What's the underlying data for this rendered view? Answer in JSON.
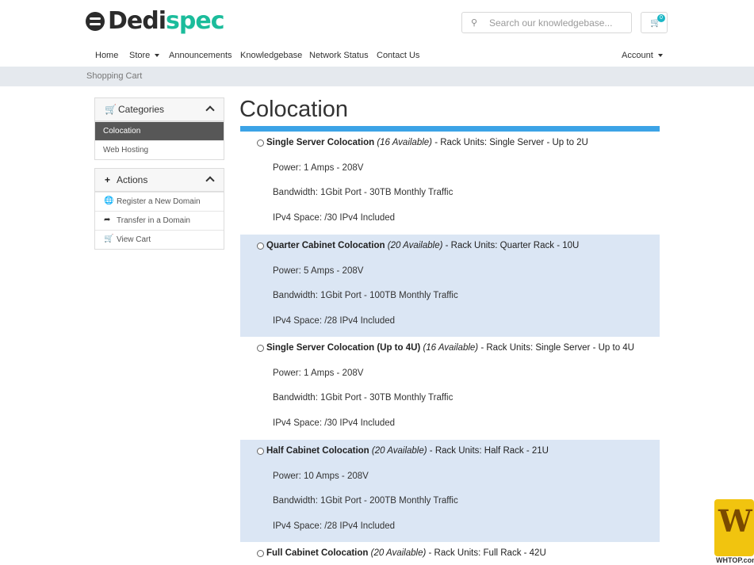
{
  "brand": {
    "part1": "Dedi",
    "part2": "spec",
    "accent": "#1bbc9b"
  },
  "search": {
    "placeholder": "Search our knowledgebase..."
  },
  "cart": {
    "count": "0"
  },
  "nav": {
    "home": "Home",
    "store": "Store",
    "announcements": "Announcements",
    "knowledgebase": "Knowledgebase",
    "network_status": "Network Status",
    "contact_us": "Contact Us",
    "account": "Account"
  },
  "breadcrumb": "Shopping Cart",
  "sidebar": {
    "categories": {
      "title": "Categories",
      "items": [
        {
          "label": "Colocation",
          "active": true
        },
        {
          "label": "Web Hosting",
          "active": false
        }
      ]
    },
    "actions": {
      "title": "Actions",
      "items": [
        {
          "label": "Register a New Domain",
          "icon": "globe-icon"
        },
        {
          "label": "Transfer in a Domain",
          "icon": "share-icon"
        },
        {
          "label": "View Cart",
          "icon": "cart-icon"
        }
      ]
    }
  },
  "page": {
    "title": "Colocation",
    "accent": "#3ca3e6"
  },
  "products": [
    {
      "name": "Single Server Colocation",
      "availability": "(16 Available)",
      "rack": " - Rack Units: Single Server - Up to 2U",
      "specs": [
        "Power: 1 Amps - 208V",
        "Bandwidth: 1Gbit Port - 30TB Monthly Traffic",
        "IPv4 Space: /30 IPv4 Included"
      ]
    },
    {
      "name": "Quarter Cabinet Colocation",
      "availability": "(20 Available)",
      "rack": " - Rack Units: Quarter Rack - 10U",
      "specs": [
        "Power: 5 Amps - 208V",
        "Bandwidth: 1Gbit Port - 100TB Monthly Traffic",
        "IPv4 Space: /28 IPv4 Included"
      ]
    },
    {
      "name": "Single Server Colocation (Up to 4U)",
      "availability": "(16 Available)",
      "rack": " - Rack Units: Single Server - Up to 4U",
      "specs": [
        "Power: 1 Amps - 208V",
        "Bandwidth: 1Gbit Port - 30TB Monthly Traffic",
        "IPv4 Space: /30 IPv4 Included"
      ]
    },
    {
      "name": "Half Cabinet Colocation",
      "availability": "(20 Available)",
      "rack": " - Rack Units: Half Rack - 21U",
      "specs": [
        "Power: 10 Amps - 208V",
        "Bandwidth: 1Gbit Port - 200TB Monthly Traffic",
        "IPv4 Space: /28 IPv4 Included"
      ]
    },
    {
      "name": "Full Cabinet Colocation",
      "availability": "(20 Available)",
      "rack": " - Rack Units: Full Rack - 42U",
      "specs": []
    }
  ],
  "watermark": {
    "glyph": "W",
    "text": "WHTOP.com"
  }
}
